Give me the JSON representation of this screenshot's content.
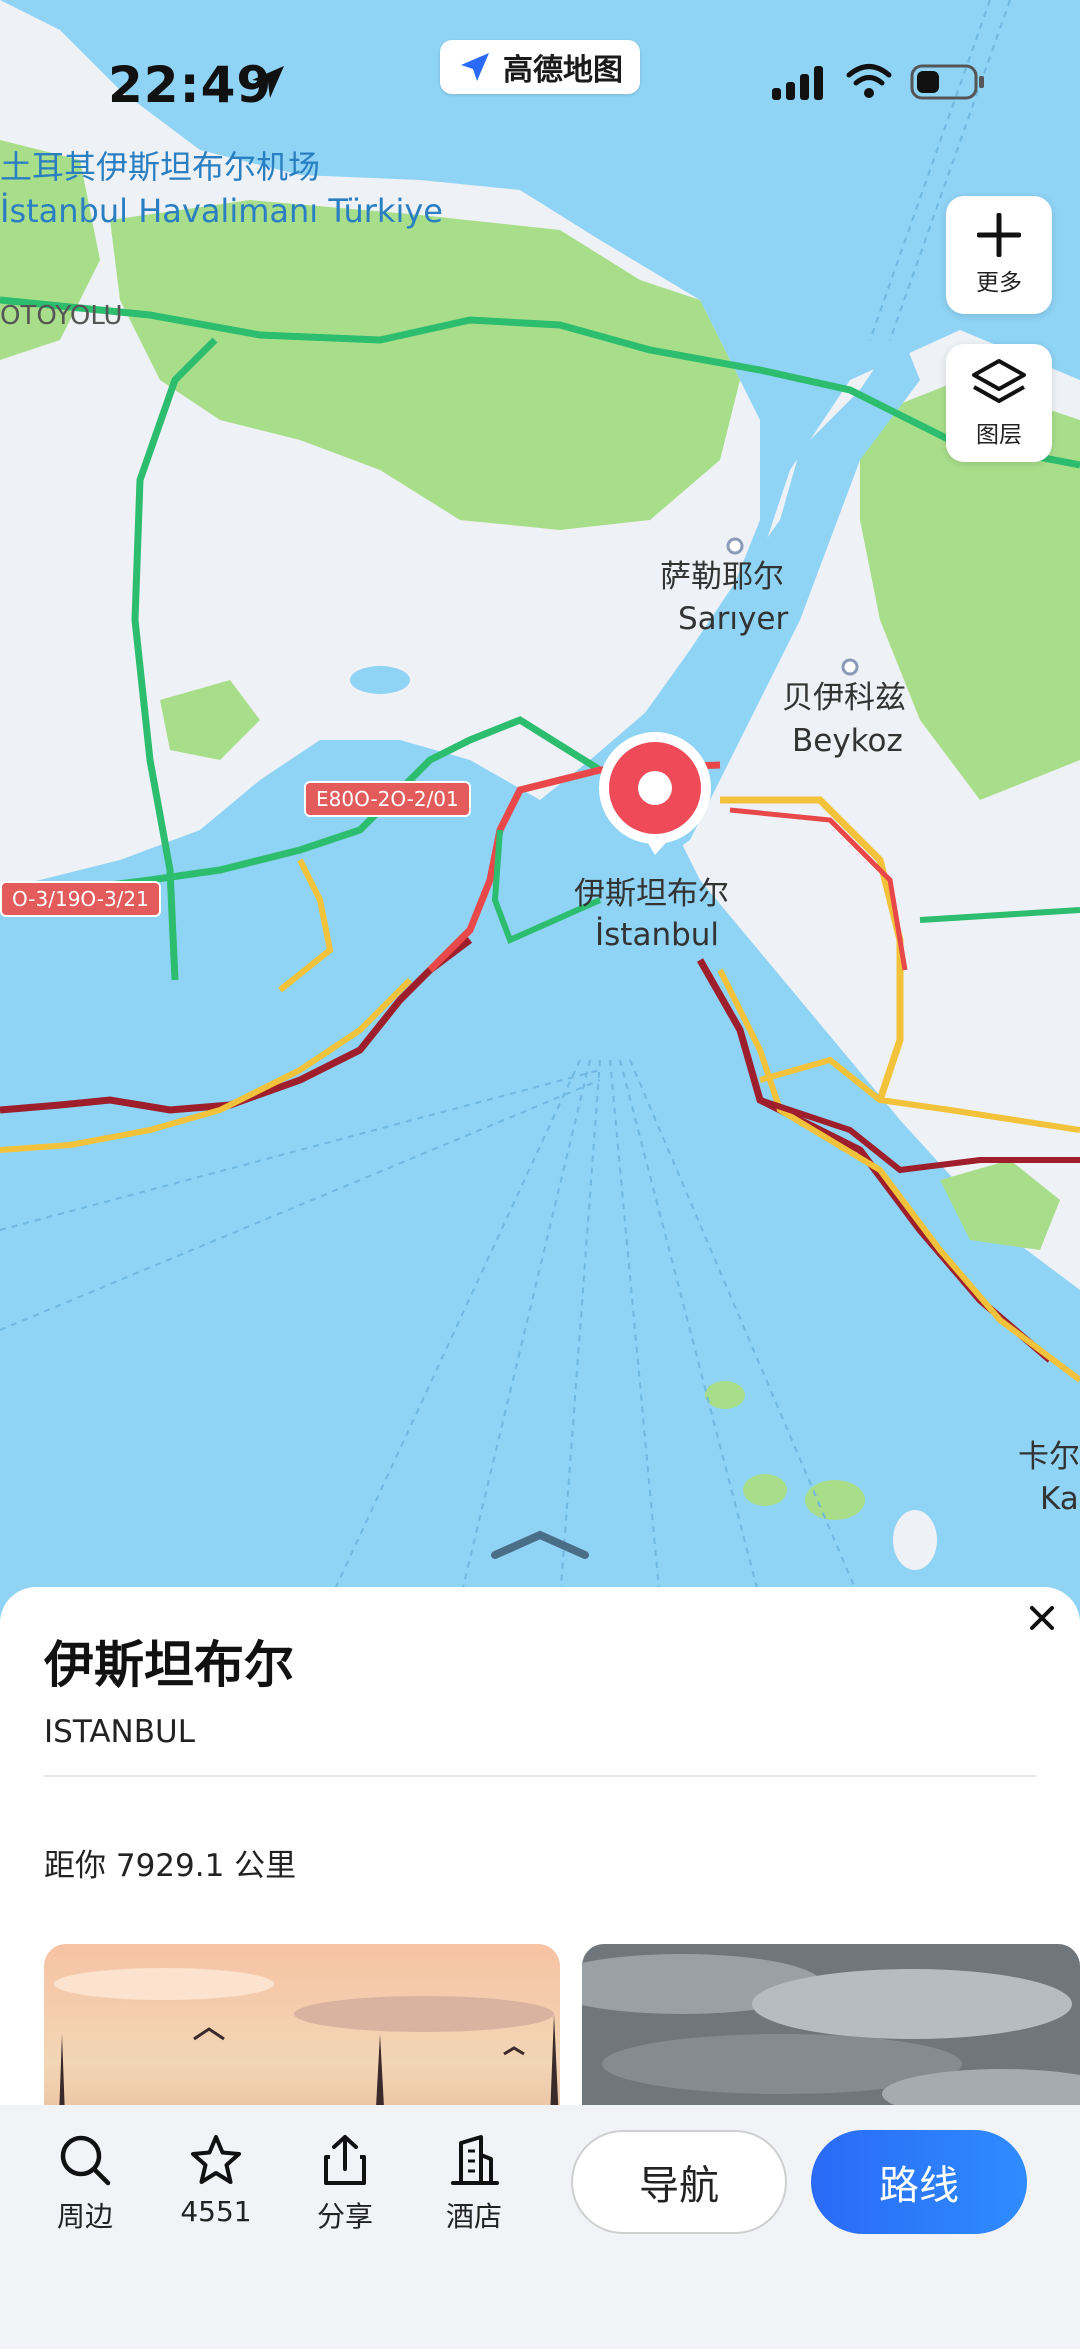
{
  "status_bar": {
    "time": "22:49",
    "app_name": "高德地图",
    "battery_level": 0.4
  },
  "map_controls": {
    "more_label": "更多",
    "layers_label": "图层"
  },
  "map_labels": {
    "airport_cn": "土耳其伊斯坦布尔机场",
    "airport_en": "İstanbul Havalimanı Türkiye",
    "road_name": "OTOYOLU",
    "sariyer_cn": "萨勒耶尔",
    "sariyer_en": "Sarıyer",
    "beykoz_cn": "贝伊科兹",
    "beykoz_en": "Beykoz",
    "istanbul_cn": "伊斯坦布尔",
    "istanbul_en": "İstanbul",
    "kartal_cn": "卡尔",
    "kartal_en": "Ka",
    "shield_1": "E80O-2O-2/01",
    "shield_2": "O-3/19O-3/21"
  },
  "place_sheet": {
    "title": "伊斯坦布尔",
    "subtitle": "ISTANBUL",
    "distance": "距你 7929.1 公里"
  },
  "toolbar": {
    "nearby_label": "周边",
    "favorites_count": "4551",
    "share_label": "分享",
    "hotel_label": "酒店",
    "navigate_label": "导航",
    "route_label": "路线"
  },
  "colors": {
    "water": "#8fd3f5",
    "land": "#eef1f5",
    "green": "#a8de8a",
    "traffic_green": "#2dbd6e",
    "traffic_yellow": "#f2c23b",
    "traffic_red": "#e8484a",
    "traffic_darkred": "#9e1e2b",
    "pin_red": "#ef4a57",
    "route_blue": "#2a6af6"
  }
}
